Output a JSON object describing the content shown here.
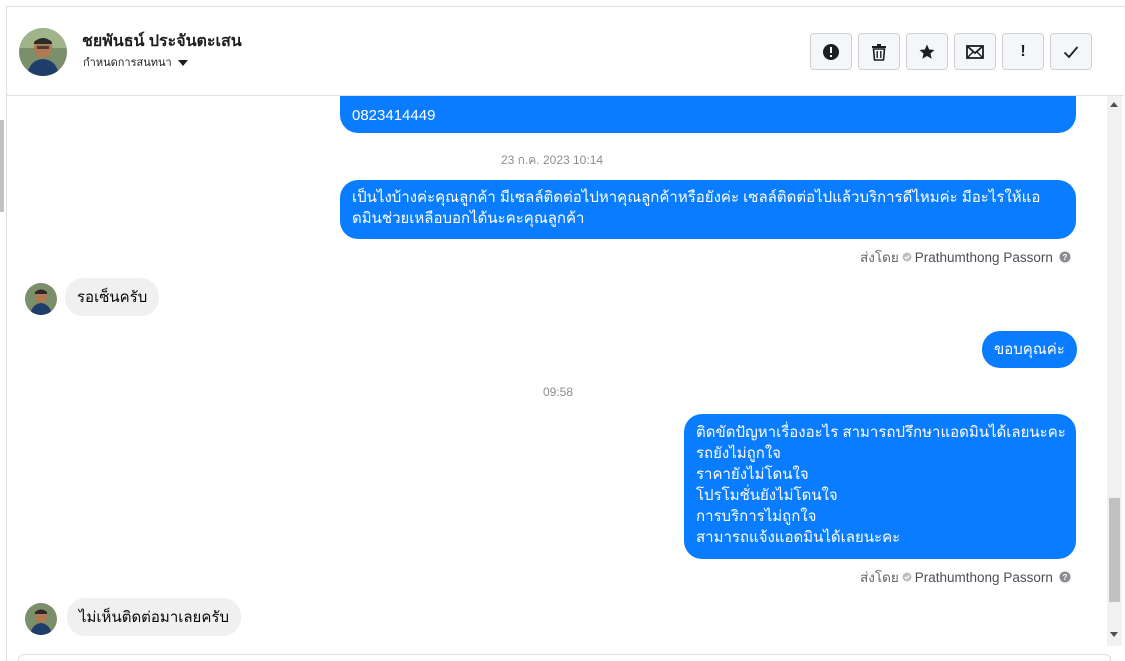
{
  "conversation": {
    "contact_name": "ชยพันธน์ ประจันตะเสน",
    "assign_label": "กำหนดการสนทนา",
    "actions": [
      {
        "name": "spam",
        "icon": "alert-circle-icon"
      },
      {
        "name": "delete",
        "icon": "trash-icon"
      },
      {
        "name": "star",
        "icon": "star-icon"
      },
      {
        "name": "mark-unread",
        "icon": "envelope-icon"
      },
      {
        "name": "follow-up",
        "icon": "exclamation-icon",
        "glyph": "!"
      },
      {
        "name": "done",
        "icon": "check-icon"
      }
    ]
  },
  "messages": {
    "m1_partial": "0823414449",
    "ts1": "23 ก.ค. 2023 10:14",
    "m2_line1": "เป็นไงบ้างค่ะคุณลูกค้า มีเซลล์ติดต่อไปหาคุณลูกค้าหรือยังค่ะ  เซลล์ติดต่อไปแล้วบริการดีไหมค่ะ มีอะไรให้แอ",
    "m2_line2": "ดมินช่วยเหลือบอกได้นะคะคุณลูกค้า",
    "sent_by_prefix": "ส่งโดย",
    "sent_by_name": "Prathumthong Passorn",
    "m3": "รอเซ็นครับ",
    "m4": "ขอบคุณค่ะ",
    "ts2": "09:58",
    "m5_lines": [
      "ติดขัดปัญหาเรื่องอะไร สามารถปรึกษาแอดมินได้เลยนะคะ",
      "รถยังไม่ถูกใจ",
      "ราคายังไม่โดนใจ",
      "โปรโมชั่นยังไม่โดนใจ",
      "การบริการไม่ถูกใจ",
      "สามารถแจ้งแอดมินได้เลยนะคะ"
    ],
    "m6": "ไม่เห็นติดต่อมาเลยครับ"
  },
  "colors": {
    "outgoing_bubble": "#0a7cff",
    "incoming_bubble": "#f0f0f0"
  }
}
